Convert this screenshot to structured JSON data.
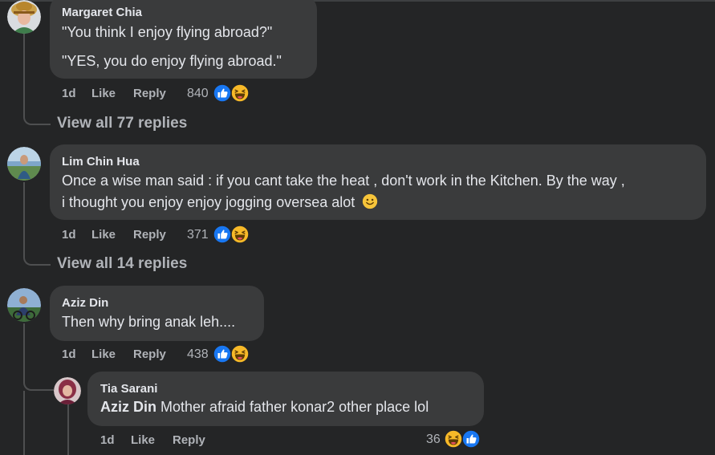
{
  "comments": [
    {
      "author": "Margaret Chia",
      "lines": [
        "\"You think I enjoy flying abroad?\"",
        "\"YES, you do enjoy flying abroad.\""
      ],
      "time": "1d",
      "like": "Like",
      "reply": "Reply",
      "reactions": "840",
      "view_replies": "View all 77 replies"
    },
    {
      "author": "Lim Chin Hua",
      "lines": [
        "Once a wise man said : if you cant take the heat , don't work in the Kitchen. By the way ,",
        "i thought you enjoy enjoy jogging oversea alot"
      ],
      "time": "1d",
      "like": "Like",
      "reply": "Reply",
      "reactions": "371",
      "view_replies": "View all 14 replies"
    },
    {
      "author": "Aziz Din",
      "lines": [
        "Then why bring anak leh...."
      ],
      "time": "1d",
      "like": "Like",
      "reply": "Reply",
      "reactions": "438"
    }
  ],
  "reply": {
    "author": "Tia Sarani",
    "mention": "Aziz Din",
    "text": " Mother afraid father konar2 other place lol",
    "time": "1d",
    "like": "Like",
    "reply": "Reply",
    "reactions": "36"
  },
  "icons": {
    "like_reaction": "thumbs-up-icon",
    "haha_reaction": "laughing-face-icon",
    "smile_emoji": "smiling-face-icon"
  },
  "colors": {
    "background": "#242526",
    "bubble": "#3a3b3c",
    "like_blue": "#1877f2",
    "emoji_yellow": "#f7b928"
  }
}
